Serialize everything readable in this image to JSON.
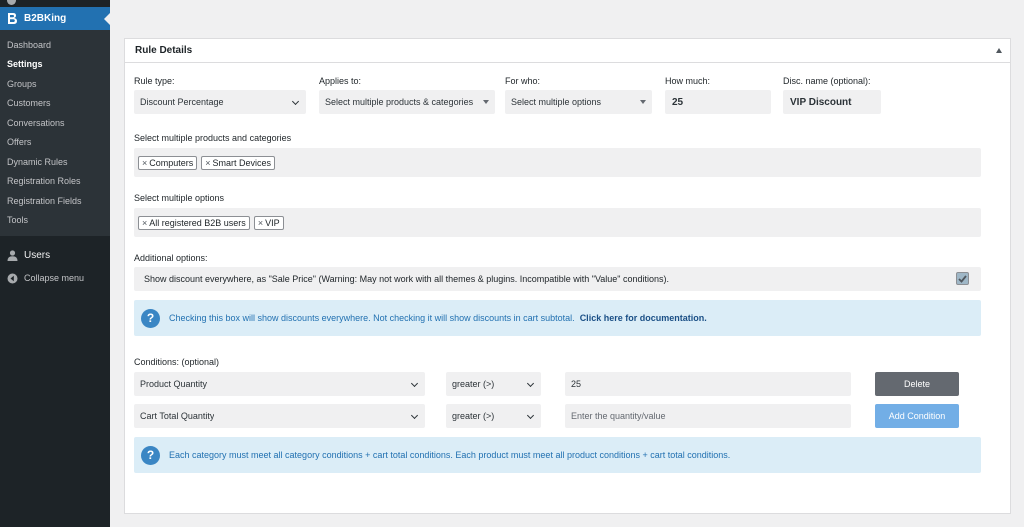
{
  "sidebar": {
    "brand": "B2BKing",
    "items": [
      {
        "label": "Dashboard",
        "active": false
      },
      {
        "label": "Settings",
        "active": true
      },
      {
        "label": "Groups",
        "active": false
      },
      {
        "label": "Customers",
        "active": false
      },
      {
        "label": "Conversations",
        "active": false
      },
      {
        "label": "Offers",
        "active": false
      },
      {
        "label": "Dynamic Rules",
        "active": false
      },
      {
        "label": "Registration Roles",
        "active": false
      },
      {
        "label": "Registration Fields",
        "active": false
      },
      {
        "label": "Tools",
        "active": false
      }
    ],
    "users_label": "Users",
    "collapse_label": "Collapse menu"
  },
  "panel": {
    "title": "Rule Details"
  },
  "rule": {
    "rule_type_label": "Rule type:",
    "rule_type_value": "Discount Percentage",
    "applies_to_label": "Applies to:",
    "applies_to_value": "Select multiple products & categories",
    "for_who_label": "For who:",
    "for_who_value": "Select multiple options",
    "how_much_label": "How much:",
    "how_much_value": "25",
    "disc_name_label": "Disc. name (optional):",
    "disc_name_value": "VIP Discount"
  },
  "products": {
    "label": "Select multiple products and categories",
    "tags": [
      "Computers",
      "Smart Devices"
    ]
  },
  "options": {
    "label": "Select multiple options",
    "tags": [
      "All registered B2B users",
      "VIP"
    ]
  },
  "additional": {
    "label": "Additional options:",
    "checkbox_text": "Show discount everywhere, as \"Sale Price\" (Warning: May not work with all themes & plugins. Incompatible with \"Value\" conditions).",
    "checked": true,
    "info_text": "Checking this box will show discounts everywhere. Not checking it will show discounts in cart subtotal.",
    "info_link": "Click here for documentation."
  },
  "conditions": {
    "label": "Conditions: (optional)",
    "rows": [
      {
        "type": "Product Quantity",
        "operator": "greater (>)",
        "value": "25",
        "placeholder": "",
        "button": "Delete"
      },
      {
        "type": "Cart Total Quantity",
        "operator": "greater (>)",
        "value": "",
        "placeholder": "Enter the quantity/value",
        "button": "Add Condition"
      }
    ],
    "info_text": "Each category must meet all category conditions + cart total conditions. Each product must meet all product conditions + cart total conditions."
  },
  "colors": {
    "sidebar_bg": "#1d2327",
    "accent": "#2271b1",
    "info_bg": "#dbedf7"
  }
}
